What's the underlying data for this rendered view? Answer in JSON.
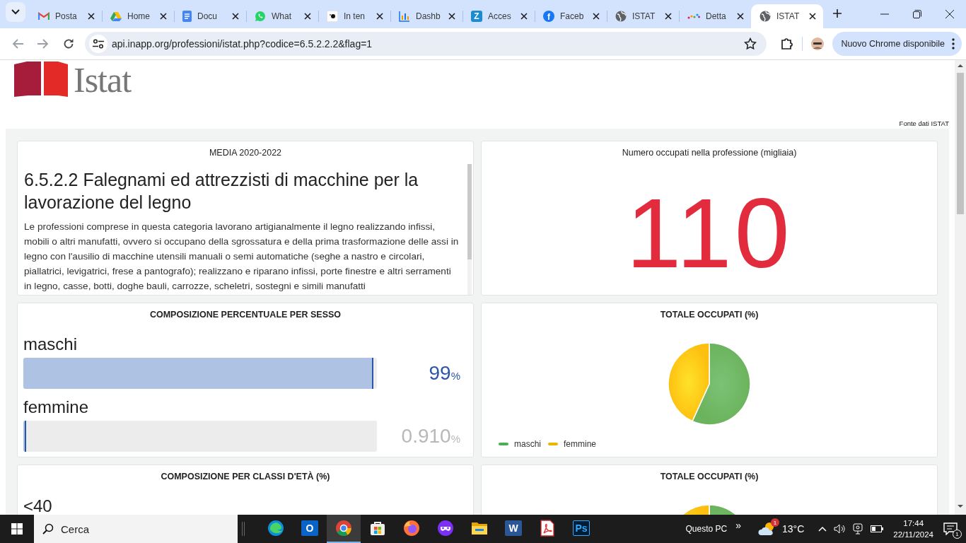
{
  "browser": {
    "tabs": [
      {
        "title": "Posta",
        "kind": "mail",
        "selected": false
      },
      {
        "title": "Home",
        "kind": "drive",
        "selected": false
      },
      {
        "title": "Docu",
        "kind": "doc",
        "selected": false
      },
      {
        "title": "What",
        "kind": "chat",
        "selected": false
      },
      {
        "title": "In ten",
        "kind": "page",
        "selected": false
      },
      {
        "title": "Dashb",
        "kind": "chart",
        "selected": false
      },
      {
        "title": "Acces",
        "kind": "letter",
        "glyph": "Z",
        "selected": false
      },
      {
        "title": "Faceb",
        "kind": "letter-round",
        "glyph": "f",
        "selected": false
      },
      {
        "title": "ISTAT",
        "kind": "globe",
        "selected": false
      },
      {
        "title": "Detta",
        "kind": "dots",
        "selected": false
      },
      {
        "title": "ISTAT",
        "kind": "globe",
        "selected": true
      }
    ],
    "url": "api.inapp.org/professioni/istat.php?codice=6.5.2.2.2&flag=1",
    "update_button": "Nuovo Chrome disponibile"
  },
  "page": {
    "logo_text": "Istat",
    "source": "Fonte dati ISTAT",
    "description_card": {
      "header": "MEDIA 2020-2022",
      "title": "6.5.2.2 Falegnami ed attrezzisti di macchine per la lavorazione del legno",
      "text": "Le professioni comprese in questa categoria lavorano artigianalmente il legno realizzando infissi, mobili o altri manufatti, ovvero si occupano della sgrossatura e della prima trasformazione delle assi in legno con l'ausilio di macchine utensili manuali o semi automatiche (seghe a nastro e circolari, piallatrici, levigatrici, frese a pantografo); realizzano e riparano infissi, porte finestre e altri serramenti in legno, casse, botti, doghe bauli, carrozze, scheletri, sostegni e simili manufatti"
    },
    "count_card": {
      "header": "Numero occupati nella professione (migliaia)",
      "value": "110"
    },
    "sex_card": {
      "header": "COMPOSIZIONE PERCENTUALE PER SESSO",
      "rows": [
        {
          "label": "maschi",
          "level": 0.99,
          "value": "99",
          "unit": "%",
          "faded": false
        },
        {
          "label": "femmine",
          "level": 0.009,
          "value": "0.910",
          "unit": "%",
          "faded": true
        }
      ]
    },
    "pie_card": {
      "header": "TOTALE OCCUPATI (%)",
      "legend": [
        {
          "label": "maschi",
          "color": "#4caf50"
        },
        {
          "label": "femmine",
          "color": "#e6b800"
        }
      ]
    },
    "age_card": {
      "header": "COMPOSIZIONE PER CLASSI D'ETÀ (%)",
      "rows": [
        {
          "label": "<40"
        }
      ]
    },
    "pie_card_2": {
      "header": "TOTALE OCCUPATI (%)"
    }
  },
  "taskbar": {
    "search_placeholder": "Cerca",
    "apps": [
      {
        "kind": "edge",
        "selected": false
      },
      {
        "kind": "outlook",
        "glyph": "O",
        "selected": false
      },
      {
        "kind": "chrome",
        "selected": true
      },
      {
        "kind": "store",
        "selected": false
      },
      {
        "kind": "firefox",
        "selected": false
      },
      {
        "kind": "mask",
        "selected": false
      },
      {
        "kind": "folder",
        "selected": false
      },
      {
        "kind": "word",
        "glyph": "W",
        "selected": false
      },
      {
        "kind": "pdf",
        "selected": false
      },
      {
        "kind": "ps",
        "glyph": "Ps",
        "selected": false
      }
    ],
    "location": "Questo PC",
    "more": "»",
    "weather_badge": "1",
    "temperature": "13°C",
    "time": "17:44",
    "date": "22/11/2024",
    "notifications": "1"
  }
}
